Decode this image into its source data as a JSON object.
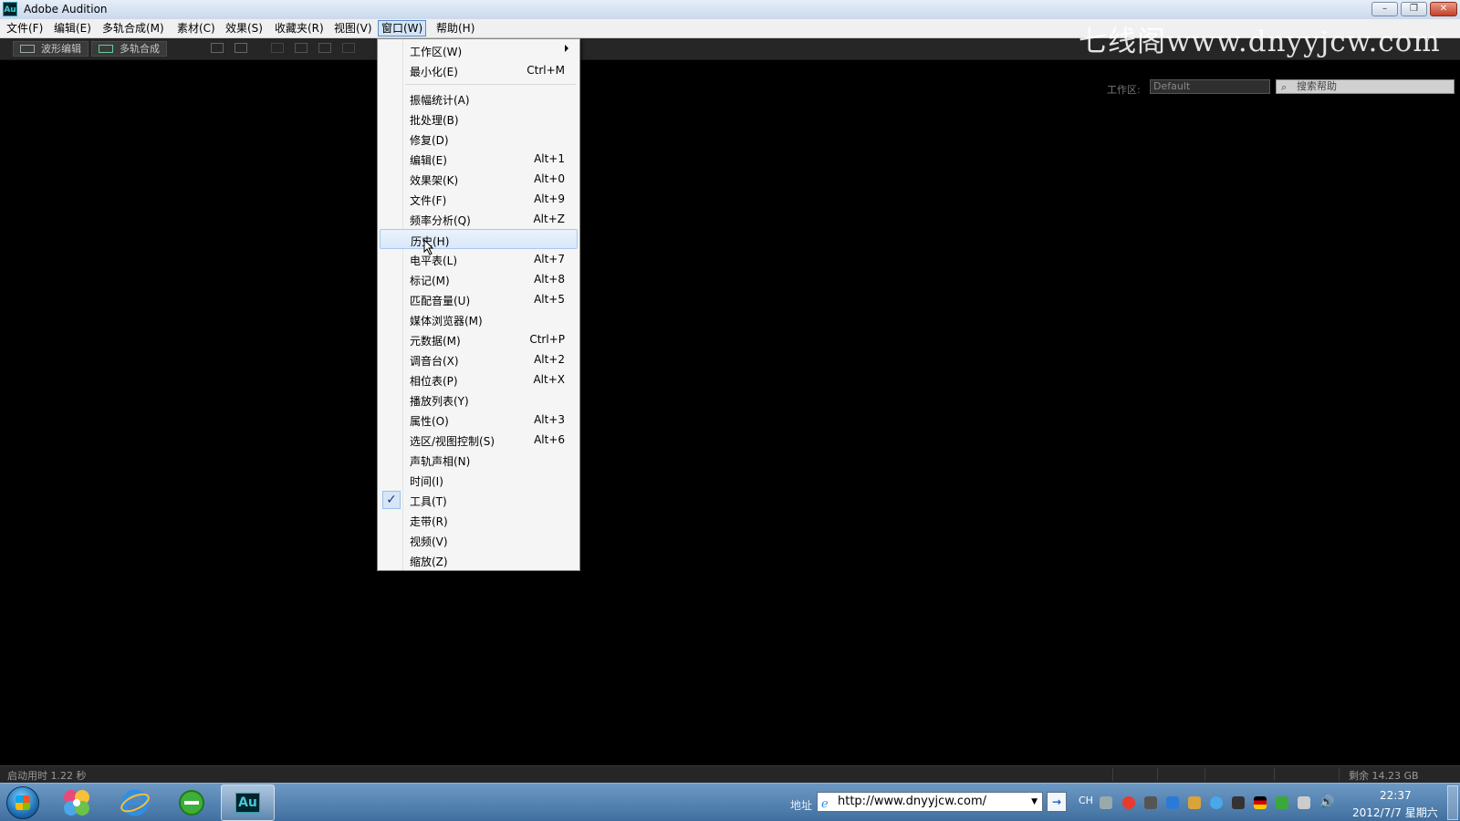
{
  "window": {
    "title": "Adobe Audition",
    "icon_text": "Au",
    "controls": [
      "minimize-icon",
      "restore-icon",
      "close-icon"
    ]
  },
  "menubar": {
    "items": [
      {
        "label": "文件(F)"
      },
      {
        "label": "编辑(E)"
      },
      {
        "label": "多轨合成(M)"
      },
      {
        "label": "素材(C)"
      },
      {
        "label": "效果(S)"
      },
      {
        "label": "收藏夹(R)"
      },
      {
        "label": "视图(V)"
      },
      {
        "label": "窗口(W)",
        "active": true
      },
      {
        "label": "帮助(H)"
      }
    ]
  },
  "toolbar": {
    "waveform_label": "波形编辑",
    "multitrack_label": "多轨合成",
    "workspace_label": "工作区:",
    "workspace_value": "Default",
    "search_placeholder": "搜索帮助"
  },
  "watermark": "七线阁www.dnyyjcw.com",
  "window_menu": {
    "items": [
      {
        "label": "工作区(W)",
        "shortcut": "",
        "submenu": true
      },
      {
        "label": "最小化(E)",
        "shortcut": "Ctrl+M"
      },
      {
        "label": "振幅统计(A)",
        "shortcut": ""
      },
      {
        "label": "批处理(B)",
        "shortcut": ""
      },
      {
        "label": "修复(D)",
        "shortcut": ""
      },
      {
        "label": "编辑(E)",
        "shortcut": "Alt+1"
      },
      {
        "label": "效果架(K)",
        "shortcut": "Alt+0"
      },
      {
        "label": "文件(F)",
        "shortcut": "Alt+9"
      },
      {
        "label": "频率分析(Q)",
        "shortcut": "Alt+Z"
      },
      {
        "label": "历史(H)",
        "shortcut": "",
        "highlighted": true
      },
      {
        "label": "电平表(L)",
        "shortcut": "Alt+7"
      },
      {
        "label": "标记(M)",
        "shortcut": "Alt+8"
      },
      {
        "label": "匹配音量(U)",
        "shortcut": "Alt+5"
      },
      {
        "label": "媒体浏览器(M)",
        "shortcut": ""
      },
      {
        "label": "元数据(M)",
        "shortcut": "Ctrl+P"
      },
      {
        "label": "调音台(X)",
        "shortcut": "Alt+2"
      },
      {
        "label": "相位表(P)",
        "shortcut": "Alt+X"
      },
      {
        "label": "播放列表(Y)",
        "shortcut": ""
      },
      {
        "label": "属性(O)",
        "shortcut": "Alt+3"
      },
      {
        "label": "选区/视图控制(S)",
        "shortcut": "Alt+6"
      },
      {
        "label": "声轨声相(N)",
        "shortcut": ""
      },
      {
        "label": "时间(I)",
        "shortcut": ""
      },
      {
        "label": "工具(T)",
        "shortcut": "",
        "checked": true
      },
      {
        "label": "走带(R)",
        "shortcut": ""
      },
      {
        "label": "视频(V)",
        "shortcut": ""
      },
      {
        "label": "缩放(Z)",
        "shortcut": ""
      }
    ]
  },
  "statusbar": {
    "startup_time": "启动用时 1.22 秒",
    "free_space": "剩余 14.23 GB"
  },
  "taskbar": {
    "address_label": "地址",
    "address_value": "http://www.dnyyjcw.com/",
    "lang": "CH",
    "time": "22:37",
    "date": "2012/7/7 星期六",
    "active_app_text": "Au"
  },
  "colors": {
    "workspace_bg": "#000000",
    "menu_highlight": "#d9e8f9",
    "audition_teal": "#49c7d6",
    "taskbar": "#4f7fae"
  }
}
